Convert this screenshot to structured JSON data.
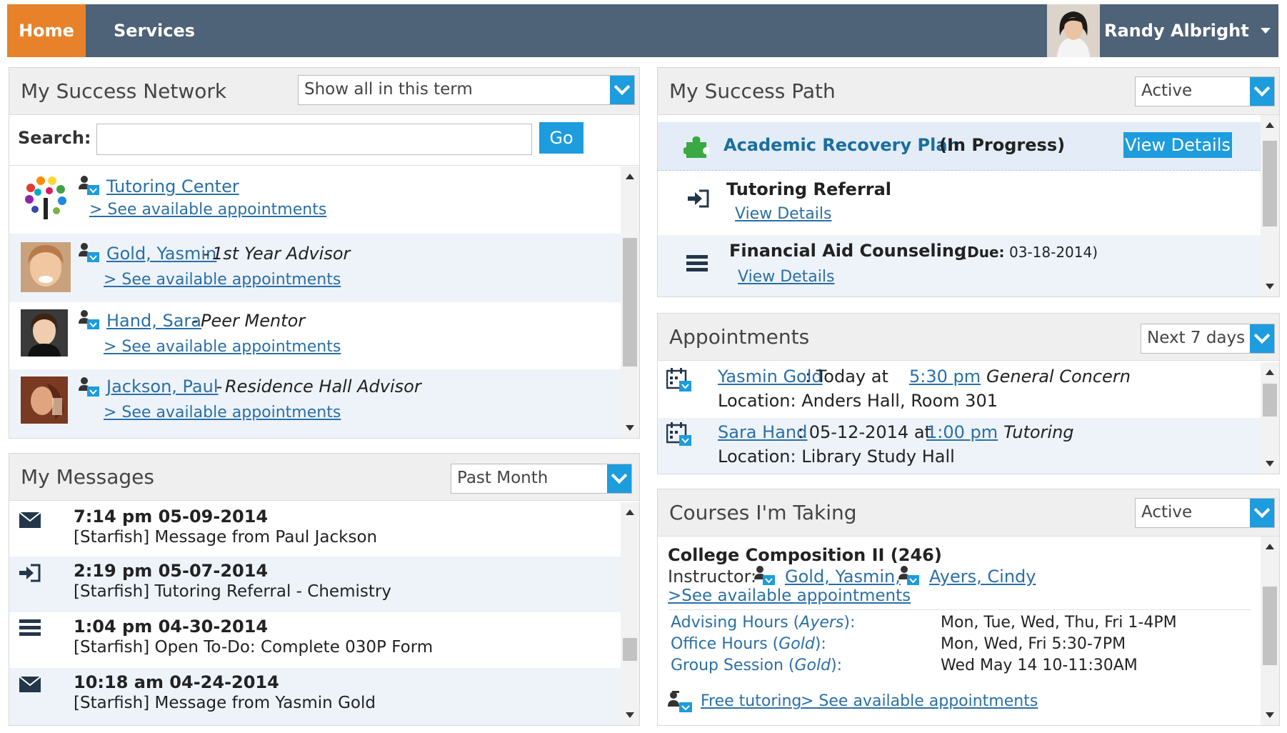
{
  "topbar": {
    "home": "Home",
    "services": "Services",
    "user_name": "Randy Albright"
  },
  "network": {
    "title": "My Success Network",
    "filter": "Show all in this term",
    "search_label": "Search:",
    "search_value": "",
    "go": "Go",
    "items": [
      {
        "name": "Tutoring Center",
        "role": "",
        "link": "> See available appointments"
      },
      {
        "name": "Gold, Yasmin",
        "role": "1st Year Advisor",
        "link": "> See available appointments"
      },
      {
        "name": "Hand, Sara",
        "role": "Peer Mentor",
        "link": "> See available appointments"
      },
      {
        "name": "Jackson, Paul",
        "role": "Residence Hall Advisor",
        "link": "> See available appointments"
      }
    ],
    "separator": " - "
  },
  "messages": {
    "title": "My Messages",
    "filter": "Past Month",
    "items": [
      {
        "icon": "envelope-icon",
        "time": "7:14 pm 05-09-2014",
        "text": "[Starfish] Message from Paul Jackson"
      },
      {
        "icon": "referral-icon",
        "time": "2:19 pm 05-07-2014",
        "text": "[Starfish] Tutoring Referral - Chemistry"
      },
      {
        "icon": "list-icon",
        "time": "1:04 pm 04-30-2014",
        "text": "[Starfish] Open To-Do: Complete 030P Form"
      },
      {
        "icon": "envelope-icon",
        "time": "10:18 am 04-24-2014",
        "text": "[Starfish] Message from Yasmin Gold"
      }
    ]
  },
  "path": {
    "title": "My Success Path",
    "filter": "Active",
    "plan_name": "Academic Recovery Plan",
    "plan_status": "(In Progress)",
    "plan_button": "View Details",
    "items": [
      {
        "icon": "referral-icon",
        "title": "Tutoring Referral",
        "due_label": "",
        "due": "",
        "link": "View Details"
      },
      {
        "icon": "list-icon",
        "title": "Financial Aid Counseling",
        "due_label": "(Due:",
        "due": "03-18-2014)",
        "link": "View Details"
      }
    ]
  },
  "appointments": {
    "title": "Appointments",
    "filter": "Next 7 days",
    "items": [
      {
        "who": "Yasmin Gold",
        "when": ": Today at ",
        "time": "5:30 pm",
        "type": "General Concern",
        "location": "Location: Anders Hall, Room 301"
      },
      {
        "who": "Sara Hand",
        "when": ": 05-12-2014 at ",
        "time": "1:00 pm",
        "type": "Tutoring",
        "location": "Location: Library Study Hall"
      }
    ]
  },
  "courses": {
    "title": "Courses I'm Taking",
    "filter": "Active",
    "course_name": "College Composition II (246)",
    "instructor_label": "Instructor:",
    "instructors": [
      "Gold, Yasmin,",
      "Ayers, Cindy"
    ],
    "appt_link": ">See available appointments",
    "hours": [
      {
        "label": "Advising Hours (",
        "who": "Ayers",
        "close": "):",
        "value": "Mon, Tue, Wed, Thu, Fri 1-4PM"
      },
      {
        "label": "Office Hours (",
        "who": "Gold",
        "close": "):",
        "value": "Mon, Wed, Fri 5:30-7PM"
      },
      {
        "label": "Group Session (",
        "who": "Gold",
        "close": "):",
        "value": "Wed May 14 10-11:30AM"
      }
    ],
    "free_tutoring": "Free tutoring",
    "free_appt_link": "> See available appointments"
  },
  "colors": {
    "accent_blue": "#1d9cde",
    "nav_bg": "#4e6278",
    "home_orange": "#e8822a",
    "link": "#2a6fa8",
    "puzzle_green": "#3aa843"
  }
}
